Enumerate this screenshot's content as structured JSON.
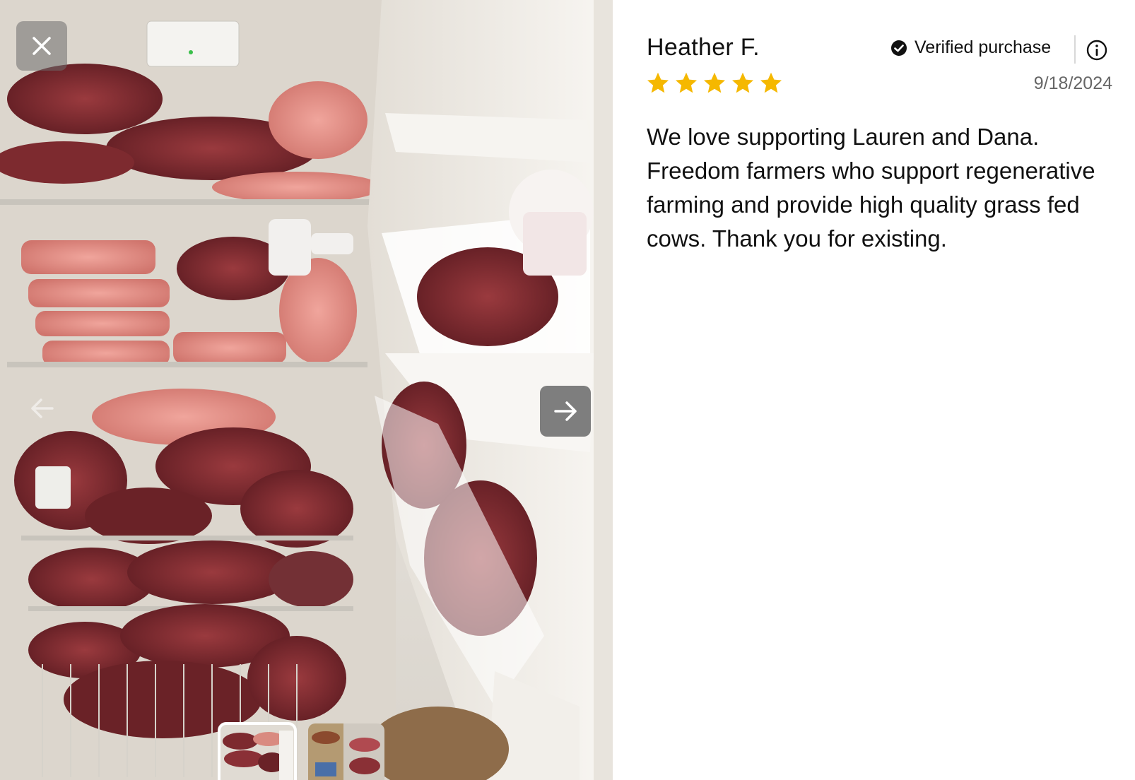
{
  "review": {
    "reviewer_name": "Heather F.",
    "verified_label": "Verified purchase",
    "rating": 5,
    "rating_max": 5,
    "date": "9/18/2024",
    "body": "We love supporting Lauren and Dana. Freedom farmers who support regenerative farming and provide high quality grass fed cows. Thank you for existing."
  },
  "gallery": {
    "images": [
      "freezer-photo-1",
      "freezer-photo-2"
    ],
    "active_index": 0
  },
  "icons": {
    "close": "close-icon",
    "prev": "arrow-left-icon",
    "next": "arrow-right-icon",
    "verified": "check-circle-icon",
    "info": "info-icon",
    "star": "star-icon"
  },
  "colors": {
    "star": "#F5B800",
    "text": "#111111",
    "muted": "#666666"
  }
}
